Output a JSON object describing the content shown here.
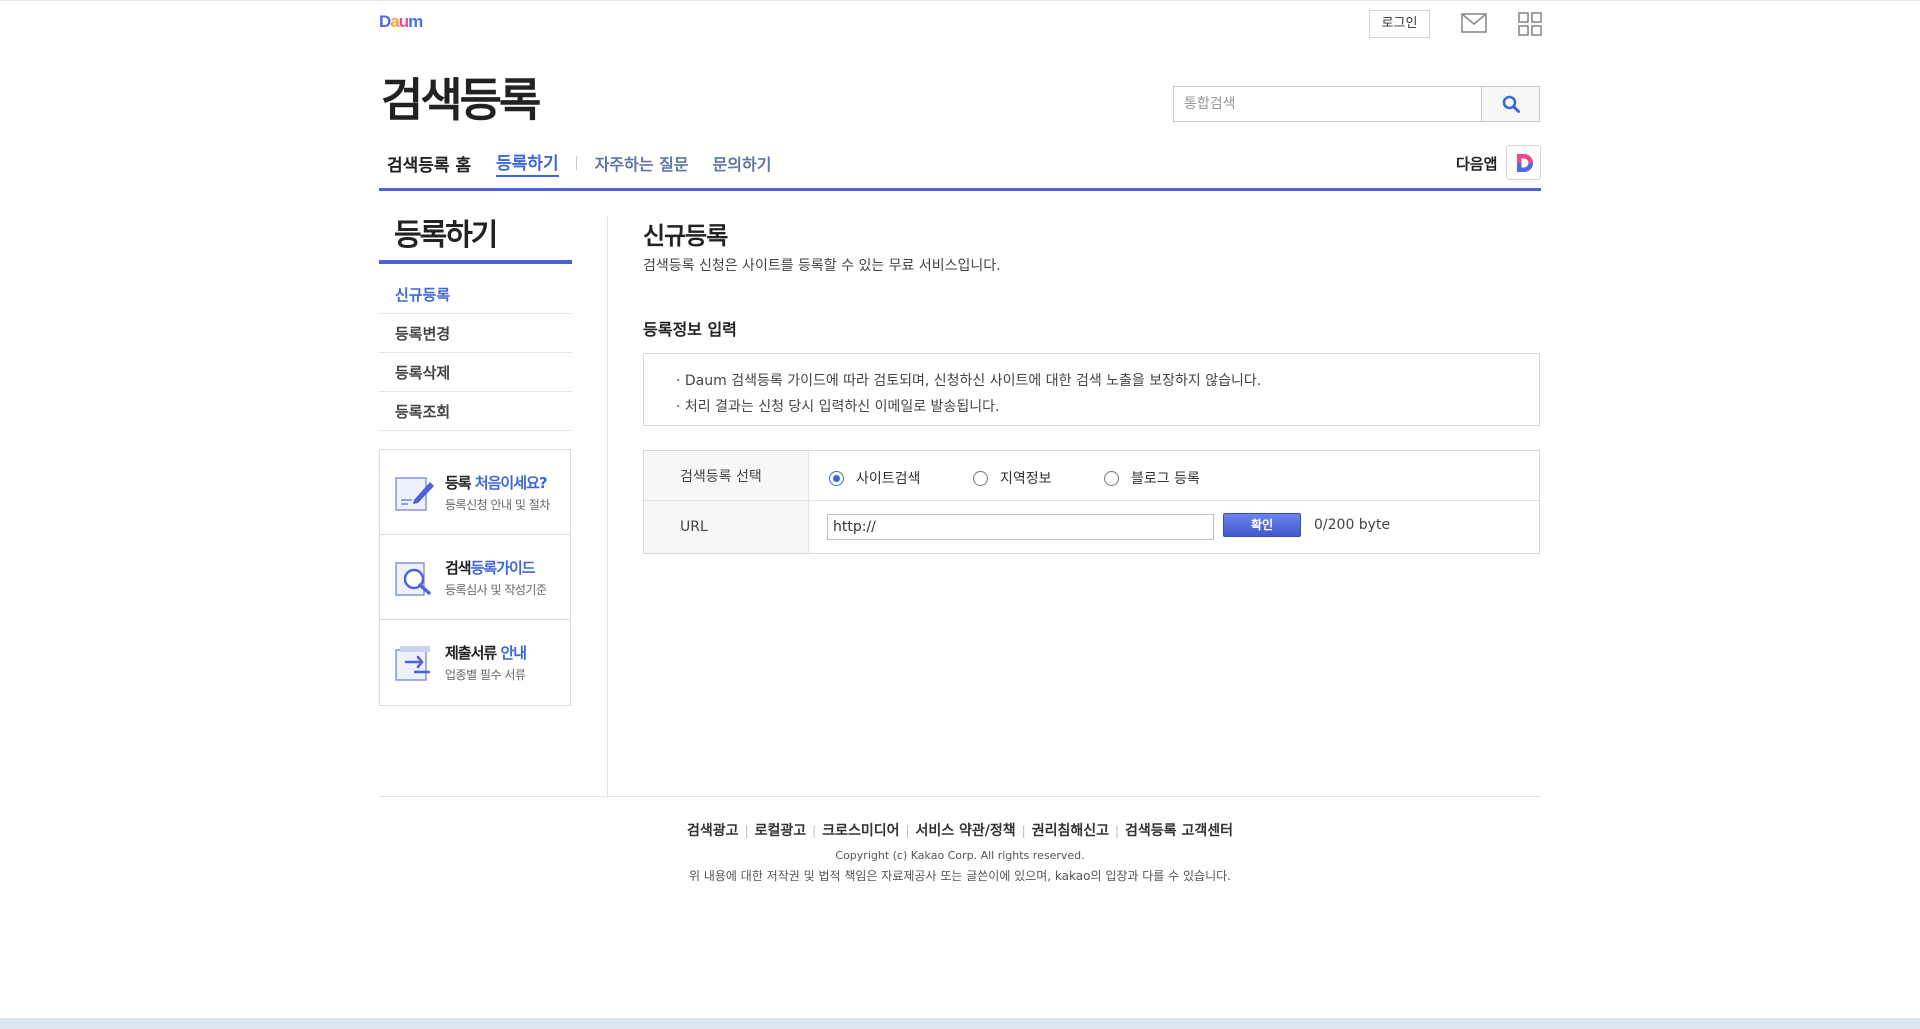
{
  "header": {
    "logo_text": "Daum",
    "login_label": "로그인",
    "service_title": "검색등록",
    "search_placeholder": "통합검색"
  },
  "gnb": {
    "home": "검색등록 홈",
    "register": "등록하기",
    "faq": "자주하는 질문",
    "inquiry": "문의하기",
    "app_label": "다음앱"
  },
  "lnb": {
    "title": "등록하기",
    "items": [
      {
        "label": "신규등록",
        "active": true
      },
      {
        "label": "등록변경"
      },
      {
        "label": "등록삭제"
      },
      {
        "label": "등록조회"
      }
    ],
    "banners": [
      {
        "title_a": "등록 ",
        "title_b": "처음이세요?",
        "desc": "등록신청 안내 및 절차"
      },
      {
        "title_a": "검색",
        "title_b": "등록가이드",
        "desc": "등록심사 및 작성기준"
      },
      {
        "title_a": "제출서류 ",
        "title_b": "안내",
        "desc": "업종별 필수 서류"
      }
    ]
  },
  "content": {
    "title": "신규등록",
    "desc": "검색등록 신청은 사이트를 등록할 수 있는 무료 서비스입니다.",
    "section_title": "등록정보 입력",
    "notices": [
      "· Daum 검색등록 가이드에 따라 검토되며, 신청하신 사이트에 대한 검색 노출을 보장하지 않습니다.",
      "· 처리 결과는 신청 당시 입력하신 이메일로 발송됩니다."
    ],
    "form": {
      "type_label": "검색등록 선택",
      "options": [
        "사이트검색",
        "지역정보",
        "블로그 등록"
      ],
      "selected": "사이트검색",
      "url_label": "URL",
      "url_value": "http://",
      "confirm_label": "확인",
      "byte_count": "0/200 byte"
    }
  },
  "footer": {
    "links": [
      "검색광고",
      "로컬광고",
      "크로스미디어",
      "서비스 약관/정책",
      "권리침해신고",
      "검색등록 고객센터"
    ],
    "copyright": "Copyright (c) Kakao Corp. All rights reserved.",
    "disclaimer": "위 내용에 대한 저작권 및 법적 책임은 자료제공사 또는 글쓴이에 있으며, kakao의 입장과 다를 수 있습니다."
  },
  "colors": {
    "accent": "#4d62d8",
    "link_active": "#3d66d9"
  }
}
